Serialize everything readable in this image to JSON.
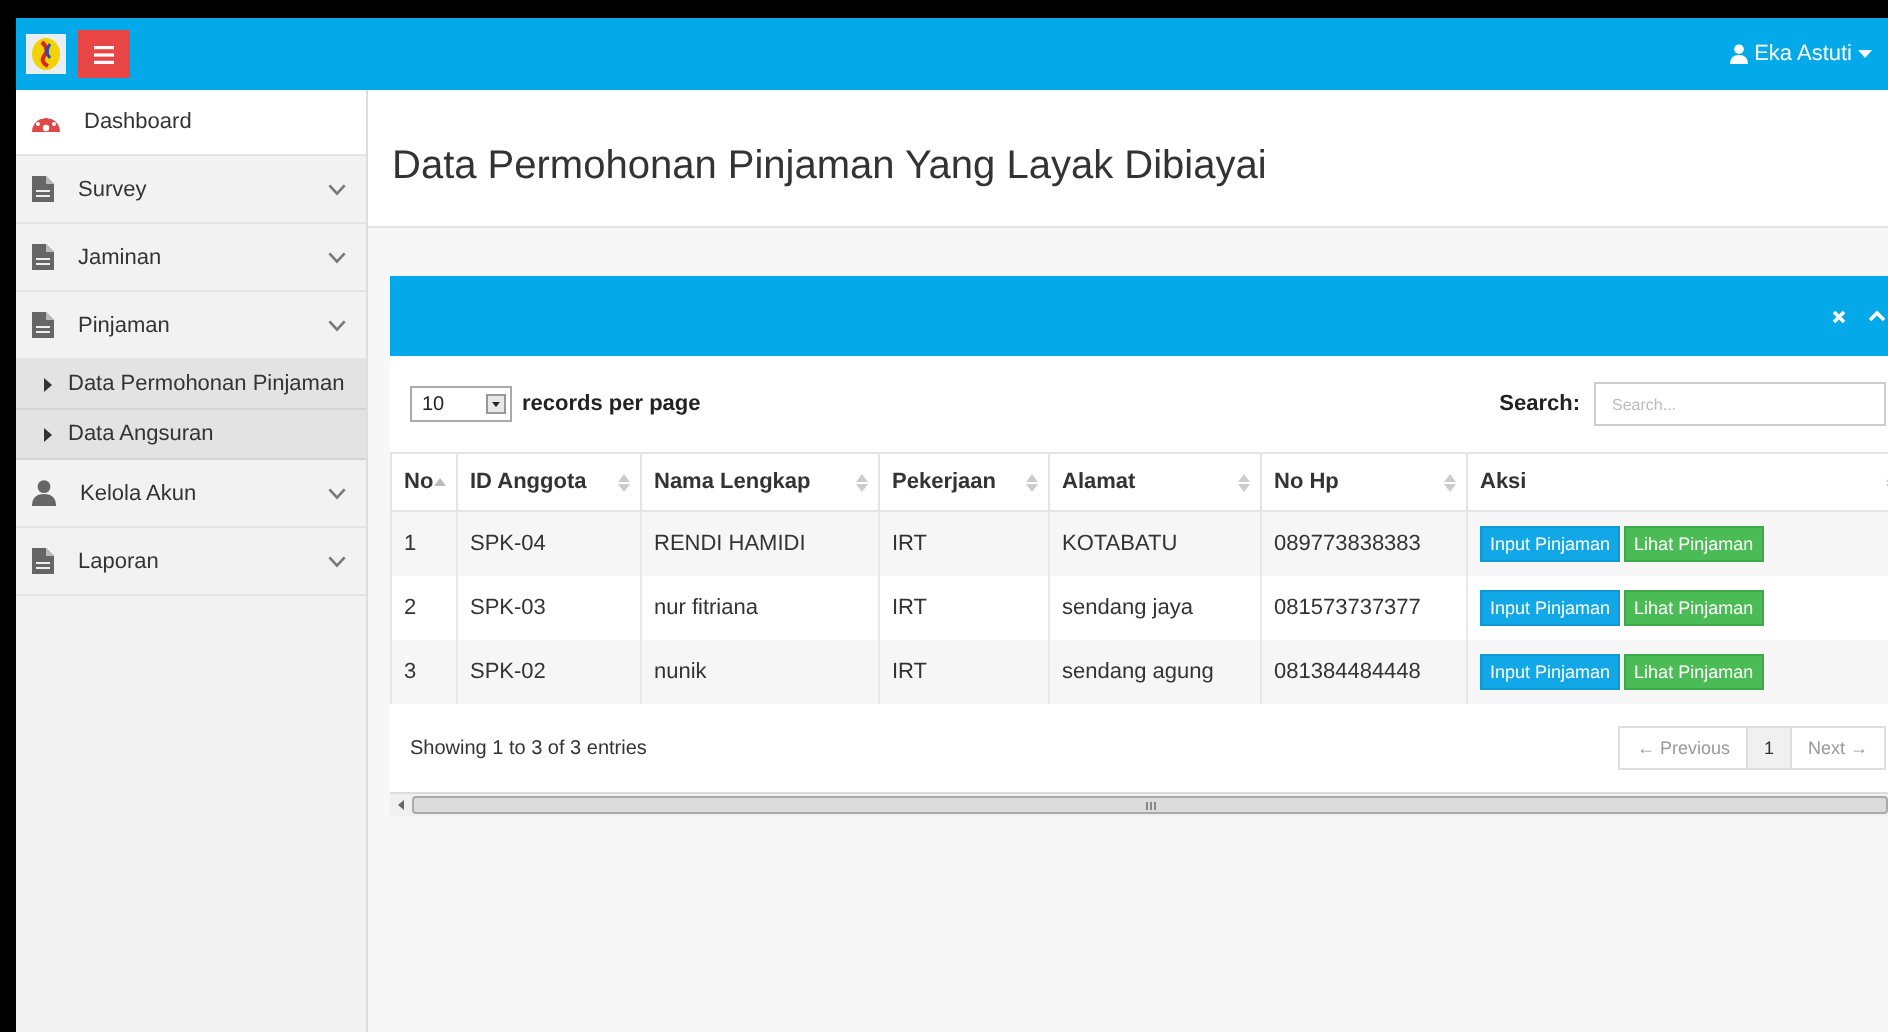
{
  "header": {
    "user": "Eka Astuti"
  },
  "sidebar": {
    "items": [
      {
        "label": "Dashboard",
        "kind": "dashboard",
        "selected": true
      },
      {
        "label": "Survey",
        "kind": "menu",
        "selected": false
      },
      {
        "label": "Jaminan",
        "kind": "menu",
        "selected": false
      },
      {
        "label": "Pinjaman",
        "kind": "menu",
        "selected": false,
        "children": [
          {
            "label": "Data Permohonan Pinjaman"
          },
          {
            "label": "Data Angsuran"
          }
        ]
      },
      {
        "label": "Kelola Akun",
        "kind": "account",
        "selected": false
      },
      {
        "label": "Laporan",
        "kind": "menu",
        "selected": false
      }
    ]
  },
  "page_title": "Data Permohonan Pinjaman Yang Layak Dibiayai",
  "table_controls": {
    "page_size": "10",
    "page_size_label": "records per page",
    "search_label": "Search:",
    "search_placeholder": "Search..."
  },
  "table": {
    "columns": [
      {
        "label": "No"
      },
      {
        "label": "ID Anggota"
      },
      {
        "label": "Nama Lengkap"
      },
      {
        "label": "Pekerjaan"
      },
      {
        "label": "Alamat"
      },
      {
        "label": "No Hp"
      },
      {
        "label": "Aksi"
      }
    ],
    "rows": [
      {
        "cells": [
          "1",
          "SPK-04",
          "RENDI HAMIDI",
          "IRT",
          "KOTABATU",
          "089773838383"
        ],
        "actions": [
          "Input Pinjaman",
          "Lihat Pinjaman"
        ]
      },
      {
        "cells": [
          "2",
          "SPK-03",
          "nur fitriana",
          "IRT",
          "sendang jaya",
          "081573737377"
        ],
        "actions": [
          "Input Pinjaman",
          "Lihat Pinjaman"
        ]
      },
      {
        "cells": [
          "3",
          "SPK-02",
          "nunik",
          "IRT",
          "sendang agung",
          "081384484448"
        ],
        "actions": [
          "Input Pinjaman",
          "Lihat Pinjaman"
        ]
      }
    ]
  },
  "table_info": "Showing 1 to 3 of 3 entries",
  "pagination": [
    {
      "label": "← Previous",
      "selected": false,
      "disabled": true
    },
    {
      "label": "1",
      "selected": true,
      "disabled": false
    },
    {
      "label": "Next →",
      "selected": false,
      "disabled": true
    }
  ]
}
